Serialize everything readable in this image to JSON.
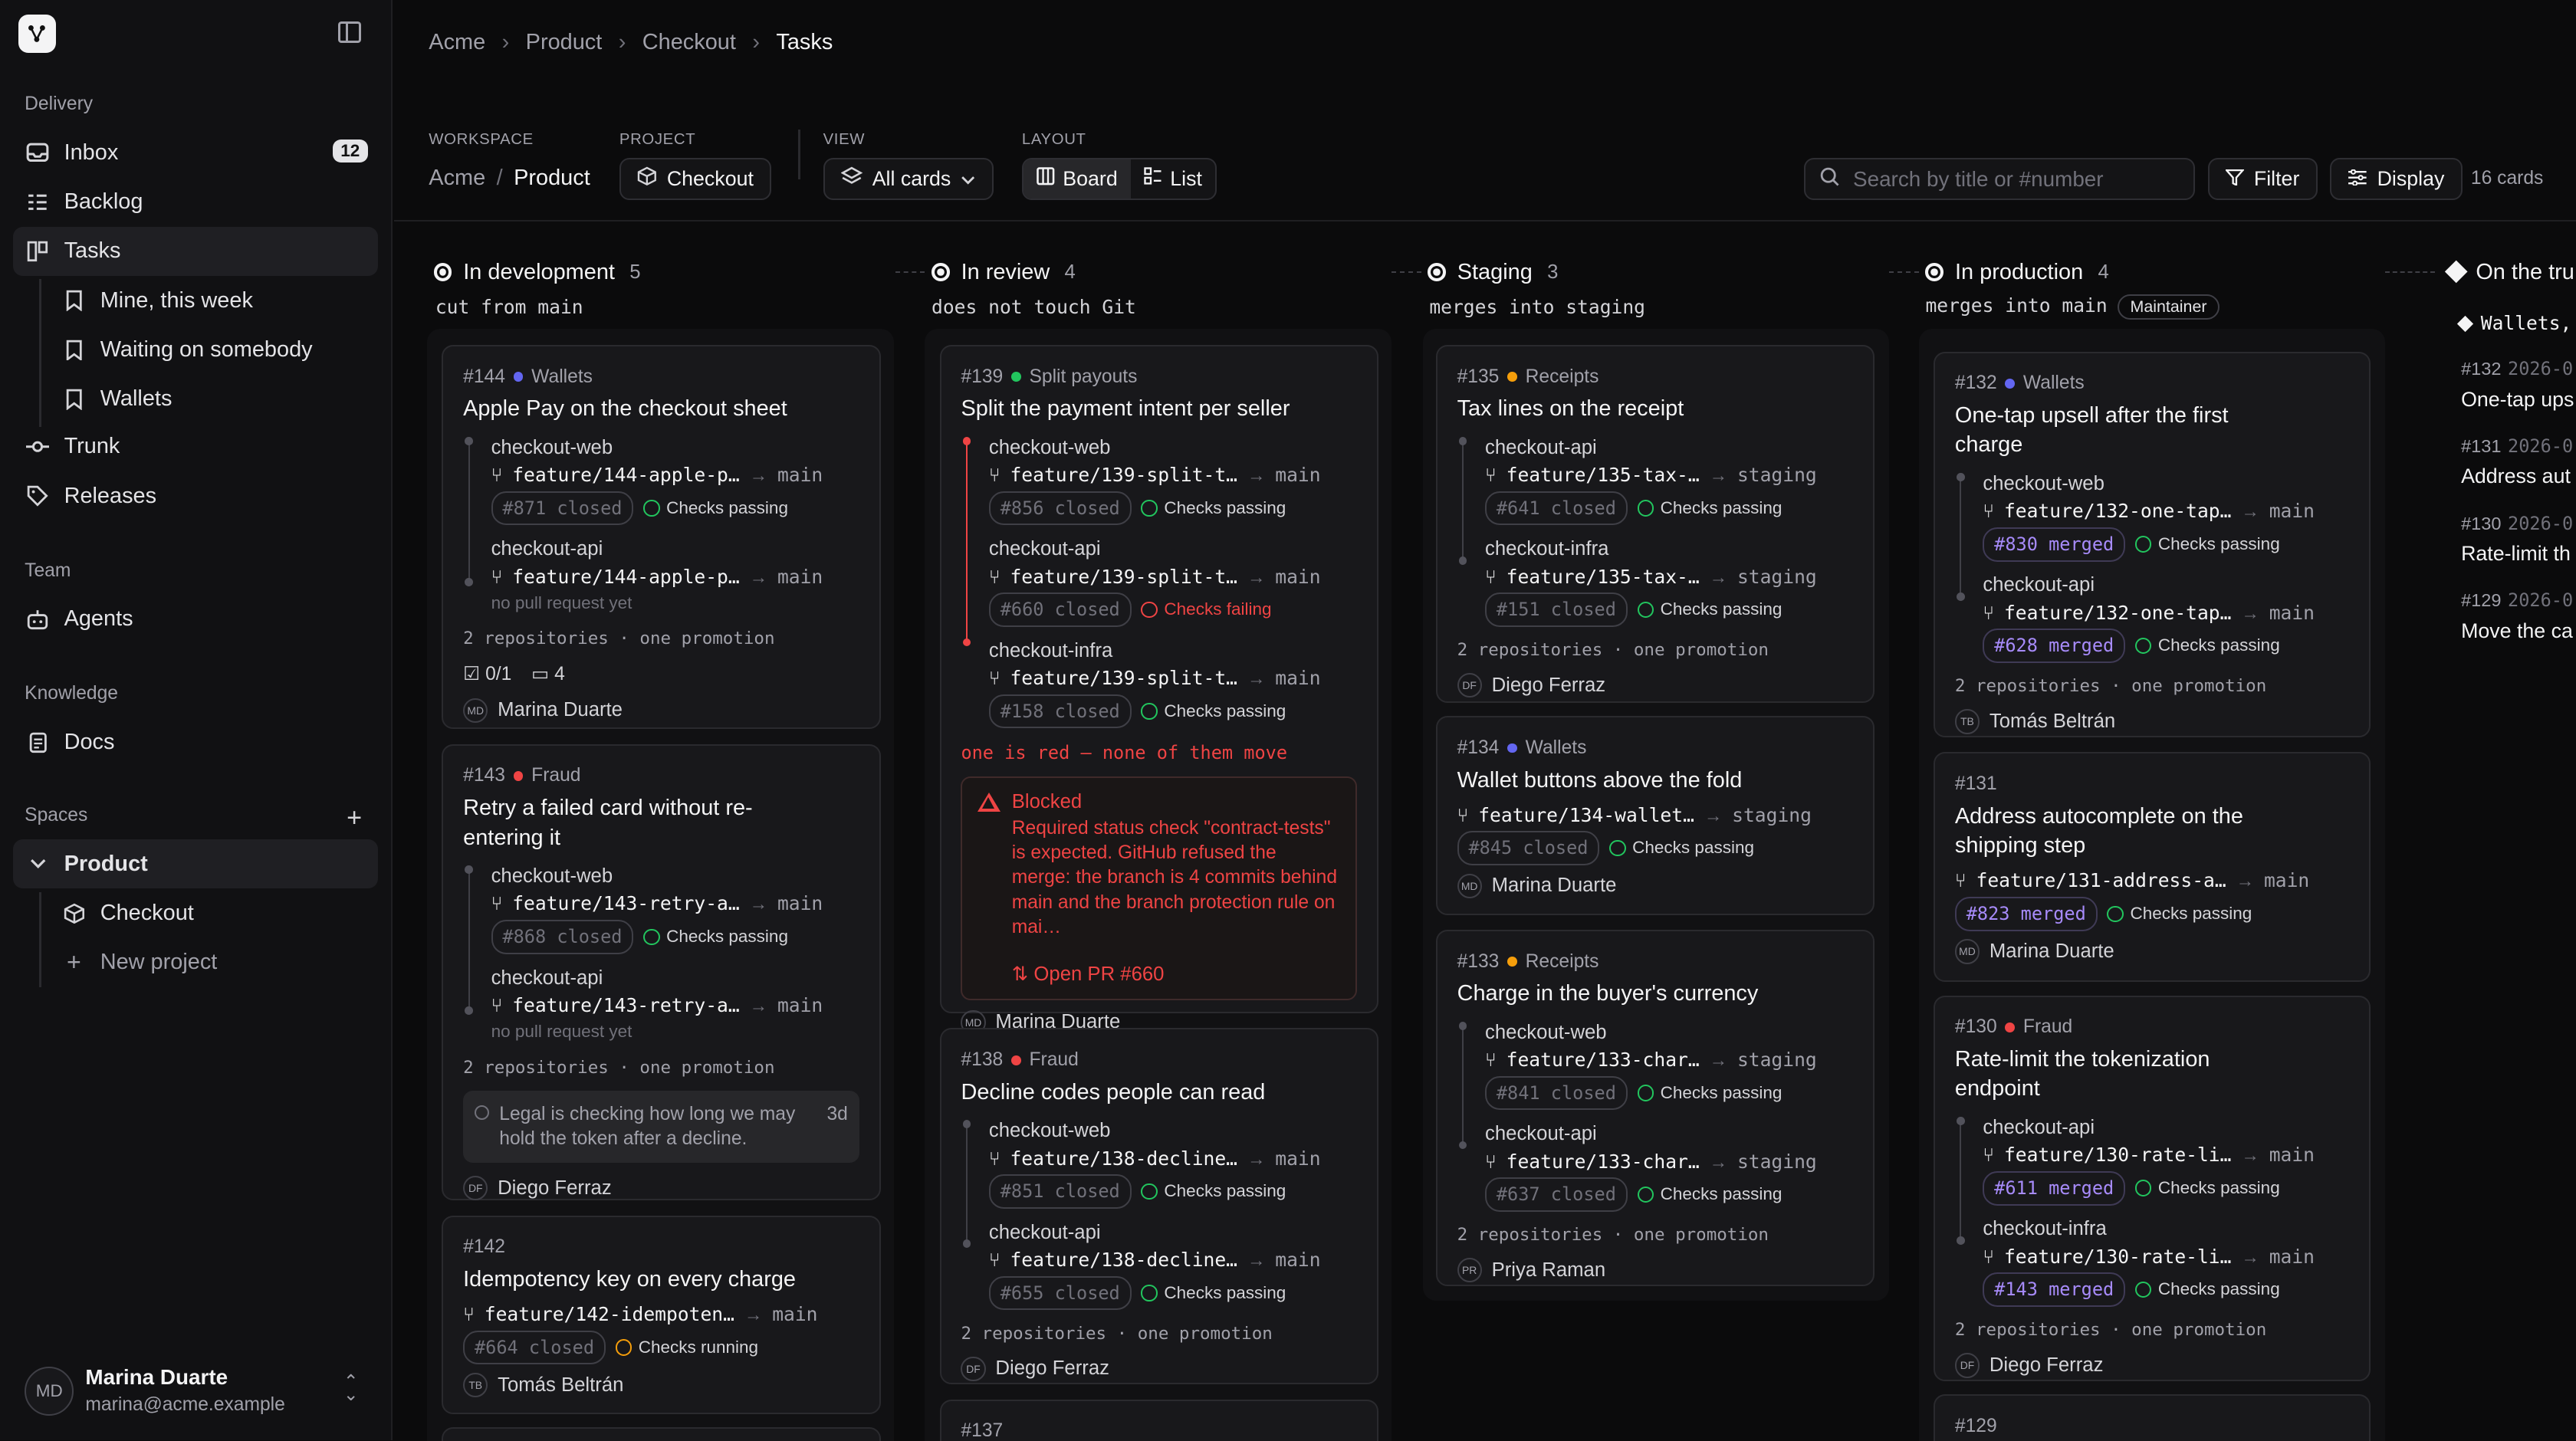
{
  "sidebar": {
    "sections": {
      "delivery": "Delivery",
      "team": "Team",
      "knowledge": "Knowledge",
      "spaces": "Spaces"
    },
    "items": {
      "inbox": "Inbox",
      "inbox_count": "12",
      "backlog": "Backlog",
      "tasks": "Tasks",
      "mine": "Mine, this week",
      "waiting": "Waiting on somebody",
      "wallets": "Wallets",
      "trunk": "Trunk",
      "releases": "Releases",
      "agents": "Agents",
      "docs": "Docs",
      "product": "Product",
      "checkout": "Checkout",
      "new_project": "New project"
    },
    "user": {
      "initials": "MD",
      "name": "Marina Duarte",
      "email": "marina@acme.example"
    }
  },
  "header": {
    "breadcrumb": [
      "Acme",
      "Product",
      "Checkout",
      "Tasks"
    ],
    "workspace_label": "WORKSPACE",
    "workspace_org": "Acme",
    "workspace_sep": "/",
    "workspace_product": "Product",
    "project_label": "PROJECT",
    "project_value": "Checkout",
    "view_label": "VIEW",
    "view_value": "All cards",
    "layout_label": "LAYOUT",
    "layout_board": "Board",
    "layout_list": "List",
    "search_placeholder": "Search by title or #number",
    "filter": "Filter",
    "display": "Display",
    "card_count": "16 cards"
  },
  "columns": [
    {
      "name": "In development",
      "count": "5",
      "rule": "cut from main"
    },
    {
      "name": "In review",
      "count": "4",
      "rule": "does not touch Git"
    },
    {
      "name": "Staging",
      "count": "3",
      "rule": "merges into staging"
    },
    {
      "name": "In production",
      "count": "4",
      "rule": "merges into main",
      "tag": "Maintainer"
    },
    {
      "name": "On the tru",
      "peek_tag": "Wallets,",
      "peek": [
        {
          "num": "#132",
          "date": "2026-0",
          "title": "One-tap ups"
        },
        {
          "num": "#131",
          "date": "2026-0",
          "title": "Address aut"
        },
        {
          "num": "#130",
          "date": "2026-0",
          "title": "Rate-limit th"
        },
        {
          "num": "#129",
          "date": "2026-0",
          "title": "Move the ca"
        }
      ]
    }
  ],
  "cards": {
    "c144": {
      "num": "#144",
      "tag": "Wallets",
      "title": "Apple Pay on the checkout sheet",
      "r1": "checkout-web",
      "b1": "feature/144-apple-p…",
      "t1": "main",
      "p1": "#871 closed",
      "k1": "Checks passing",
      "r2": "checkout-api",
      "b2": "feature/144-apple-p…",
      "t2": "main",
      "n2": "no pull request yet",
      "summary": "2 repositories · one promotion",
      "subtasks": "0/1",
      "comments": "4",
      "av": "MD",
      "person": "Marina Duarte"
    },
    "c143": {
      "num": "#143",
      "tag": "Fraud",
      "title": "Retry a failed card without re-entering it",
      "r1": "checkout-web",
      "b1": "feature/143-retry-a…",
      "t1": "main",
      "p1": "#868 closed",
      "k1": "Checks passing",
      "r2": "checkout-api",
      "b2": "feature/143-retry-a…",
      "t2": "main",
      "n2": "no pull request yet",
      "summary": "2 repositories · one promotion",
      "note": "Legal is checking how long we may hold the token after a decline.",
      "note_age": "3d",
      "av": "DF",
      "person": "Diego Ferraz"
    },
    "c142": {
      "num": "#142",
      "title": "Idempotency key on every charge",
      "b1": "feature/142-idempoten…",
      "t1": "main",
      "p1": "#664 closed",
      "k1": "Checks running",
      "av": "TB",
      "person": "Tomás Beltrán"
    },
    "c139": {
      "num": "#139",
      "tag": "Split payouts",
      "title": "Split the payment intent per seller",
      "r1": "checkout-web",
      "b1": "feature/139-split-t…",
      "t1": "main",
      "p1": "#856 closed",
      "k1": "Checks passing",
      "r2": "checkout-api",
      "b2": "feature/139-split-t…",
      "t2": "main",
      "p2": "#660 closed",
      "k2": "Checks failing",
      "r3": "checkout-infra",
      "b3": "feature/139-split-t…",
      "t3": "main",
      "p3": "#158 closed",
      "k3": "Checks passing",
      "redline": "one is red — none of them move",
      "blocked_title": "Blocked",
      "blocked_body": "Required status check \"contract-tests\" is expected. GitHub refused the merge: the branch is 4 commits behind main and the branch protection rule on mai…",
      "blocked_link": "Open PR #660",
      "av": "MD",
      "person": "Marina Duarte"
    },
    "c138": {
      "num": "#138",
      "tag": "Fraud",
      "title": "Decline codes people can read",
      "r1": "checkout-web",
      "b1": "feature/138-decline…",
      "t1": "main",
      "p1": "#851 closed",
      "k1": "Checks passing",
      "r2": "checkout-api",
      "b2": "feature/138-decline…",
      "t2": "main",
      "p2": "#655 closed",
      "k2": "Checks passing",
      "summary": "2 repositories · one promotion",
      "av": "DF",
      "person": "Diego Ferraz"
    },
    "c137": {
      "num": "#137"
    },
    "c135": {
      "num": "#135",
      "tag": "Receipts",
      "title": "Tax lines on the receipt",
      "r1": "checkout-api",
      "b1": "feature/135-tax-…",
      "t1": "staging",
      "p1": "#641 closed",
      "k1": "Checks passing",
      "r2": "checkout-infra",
      "b2": "feature/135-tax-…",
      "t2": "staging",
      "p2": "#151 closed",
      "k2": "Checks passing",
      "summary": "2 repositories · one promotion",
      "av": "DF",
      "person": "Diego Ferraz"
    },
    "c134": {
      "num": "#134",
      "tag": "Wallets",
      "title": "Wallet buttons above the fold",
      "b1": "feature/134-wallet…",
      "t1": "staging",
      "p1": "#845 closed",
      "k1": "Checks passing",
      "av": "MD",
      "person": "Marina Duarte"
    },
    "c133": {
      "num": "#133",
      "tag": "Receipts",
      "title": "Charge in the buyer's currency",
      "r1": "checkout-web",
      "b1": "feature/133-char…",
      "t1": "staging",
      "p1": "#841 closed",
      "k1": "Checks passing",
      "r2": "checkout-api",
      "b2": "feature/133-char…",
      "t2": "staging",
      "p2": "#637 closed",
      "k2": "Checks passing",
      "summary": "2 repositories · one promotion",
      "av": "PR",
      "person": "Priya Raman"
    },
    "c132": {
      "num": "#132",
      "tag": "Wallets",
      "title": "One-tap upsell after the first charge",
      "r1": "checkout-web",
      "b1": "feature/132-one-tap…",
      "t1": "main",
      "p1": "#830 merged",
      "k1": "Checks passing",
      "r2": "checkout-api",
      "b2": "feature/132-one-tap…",
      "t2": "main",
      "p2": "#628 merged",
      "k2": "Checks passing",
      "summary": "2 repositories · one promotion",
      "av": "TB",
      "person": "Tomás Beltrán"
    },
    "c131": {
      "num": "#131",
      "title": "Address autocomplete on the shipping step",
      "b1": "feature/131-address-a…",
      "t1": "main",
      "p1": "#823 merged",
      "k1": "Checks passing",
      "av": "MD",
      "person": "Marina Duarte"
    },
    "c130": {
      "num": "#130",
      "tag": "Fraud",
      "title": "Rate-limit the tokenization endpoint",
      "r1": "checkout-api",
      "b1": "feature/130-rate-li…",
      "t1": "main",
      "p1": "#611 merged",
      "k1": "Checks passing",
      "r2": "checkout-infra",
      "b2": "feature/130-rate-li…",
      "t2": "main",
      "p2": "#143 merged",
      "k2": "Checks passing",
      "summary": "2 repositories · one promotion",
      "av": "DF",
      "person": "Diego Ferraz"
    },
    "c129": {
      "num": "#129"
    }
  },
  "colors": {
    "wallets": "#6366f1",
    "fraud": "#ef4444",
    "split": "#22c55e",
    "receipts": "#f59e0b",
    "merged": "#a78bfa",
    "pass": "#22c55e",
    "fail": "#ef4444",
    "running": "#f59e0b"
  },
  "icons": [
    "logo-icon",
    "sidebar-toggle-icon",
    "inbox-icon",
    "backlog-icon",
    "tasks-icon",
    "bookmark-icon",
    "trunk-icon",
    "tag-icon",
    "bot-icon",
    "doc-icon",
    "box-icon",
    "plus-icon",
    "chevron-icon",
    "search-icon",
    "filter-icon",
    "display-icon",
    "branch-icon",
    "pr-icon",
    "check-icon",
    "warning-icon"
  ]
}
